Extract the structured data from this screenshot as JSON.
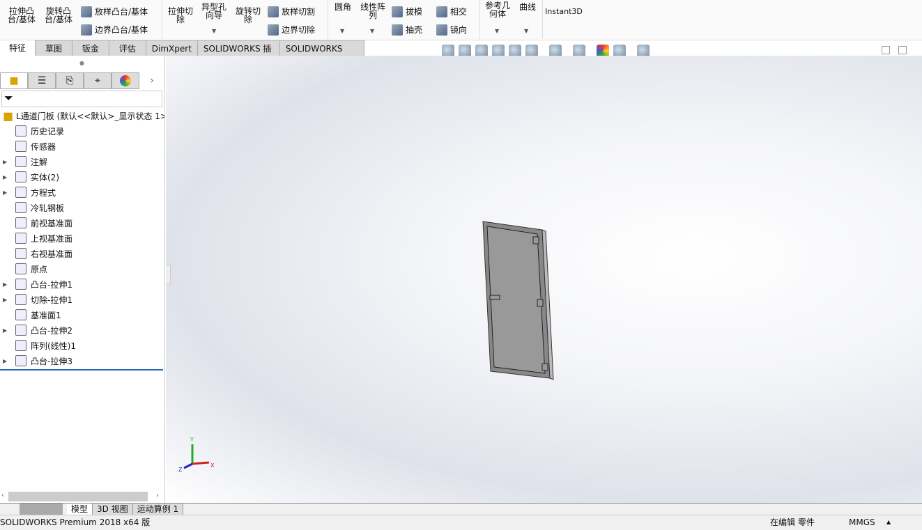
{
  "ribbon": {
    "extrude_boss": "拉伸凸台/基体",
    "revolve_boss": "旋转凸台/基体",
    "loft_boss": "放样凸台/基体",
    "boundary_boss": "边界凸台/基体",
    "extrude_cut": "拉伸切除",
    "hole_wizard": "异型孔向导",
    "revolve_cut": "旋转切除",
    "loft_cut": "放样切割",
    "boundary_cut": "边界切除",
    "fillet": "圆角",
    "linear_pattern": "线性阵列",
    "draft": "拔模",
    "intersect": "相交",
    "shell": "抽壳",
    "mirror": "镜向",
    "ref_geometry": "参考几何体",
    "curves": "曲线",
    "instant3d": "Instant3D"
  },
  "tabs": [
    "特征",
    "草图",
    "钣金",
    "评估",
    "DimXpert",
    "SOLIDWORKS 插件",
    "SOLIDWORKS MBD"
  ],
  "tree": {
    "root": "L通道门板  (默认<<默认>_显示状态 1>",
    "items": [
      {
        "label": "历史记录",
        "exp": false
      },
      {
        "label": "传感器",
        "exp": false
      },
      {
        "label": "注解",
        "exp": true
      },
      {
        "label": "实体(2)",
        "exp": true
      },
      {
        "label": "方程式",
        "exp": true
      },
      {
        "label": "冷轧钢板",
        "exp": false
      },
      {
        "label": "前视基准面",
        "exp": false
      },
      {
        "label": "上视基准面",
        "exp": false
      },
      {
        "label": "右视基准面",
        "exp": false
      },
      {
        "label": "原点",
        "exp": false
      },
      {
        "label": "凸台-拉伸1",
        "exp": true
      },
      {
        "label": "切除-拉伸1",
        "exp": true
      },
      {
        "label": "基准面1",
        "exp": false
      },
      {
        "label": "凸台-拉伸2",
        "exp": true
      },
      {
        "label": "阵列(线性)1",
        "exp": false
      },
      {
        "label": "凸台-拉伸3",
        "exp": true
      }
    ]
  },
  "triad": {
    "x": "X",
    "y": "Y",
    "z": "Z"
  },
  "bottom_tabs": [
    "模型",
    "3D 视图",
    "运动算例 1"
  ],
  "status": {
    "product": "SOLIDWORKS Premium 2018 x64 版",
    "mode": "在编辑 零件",
    "units": "MMGS"
  }
}
